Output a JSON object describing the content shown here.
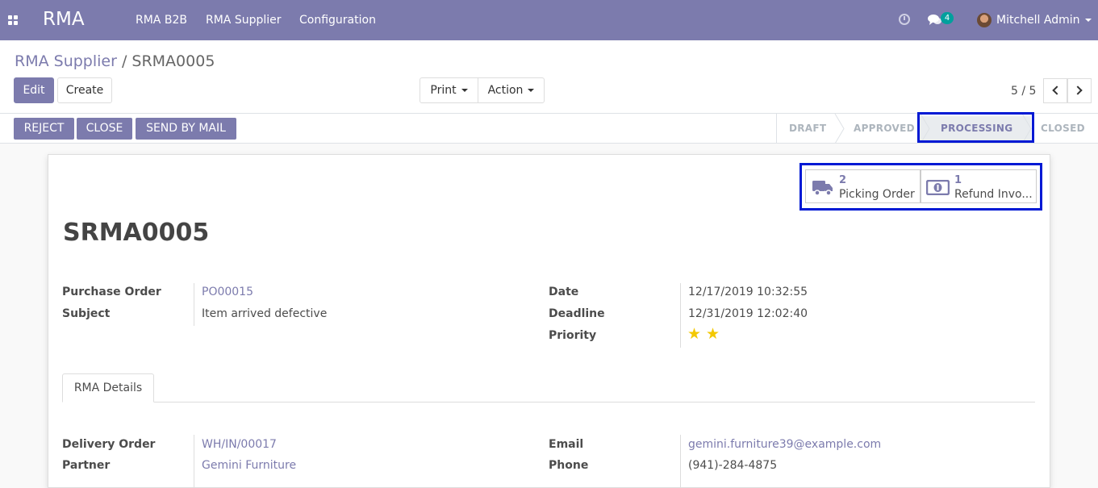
{
  "navbar": {
    "app_name": "RMA",
    "menus": [
      "RMA B2B",
      "RMA Supplier",
      "Configuration"
    ],
    "chat_badge": "4",
    "user_name": "Mitchell Admin",
    "color": "#7c7bad"
  },
  "breadcrumb": {
    "parent": "RMA Supplier",
    "separator": " / ",
    "current": "SRMA0005"
  },
  "buttons": {
    "edit": "Edit",
    "create": "Create",
    "print": "Print",
    "action": "Action"
  },
  "pager": {
    "text": "5 / 5"
  },
  "status_buttons": {
    "reject": "REJECT",
    "close": "CLOSE",
    "send_mail": "SEND BY MAIL"
  },
  "stages": [
    {
      "label": "DRAFT",
      "active": false
    },
    {
      "label": "APPROVED",
      "active": false
    },
    {
      "label": "PROCESSING",
      "active": true
    },
    {
      "label": "CLOSED",
      "active": false
    }
  ],
  "smart_buttons": [
    {
      "count": "2",
      "label": "Picking Order",
      "icon": "truck-icon"
    },
    {
      "count": "1",
      "label": "Refund Invo...",
      "icon": "money-icon"
    }
  ],
  "record": {
    "name": "SRMA0005",
    "purchase_order_label": "Purchase Order",
    "purchase_order": "PO00015",
    "subject_label": "Subject",
    "subject": "Item arrived defective",
    "date_label": "Date",
    "date": "12/17/2019 10:32:55",
    "deadline_label": "Deadline",
    "deadline": "12/31/2019 12:02:40",
    "priority_label": "Priority",
    "priority_stars": 2
  },
  "tabs": {
    "details": "RMA Details"
  },
  "details": {
    "delivery_order_label": "Delivery Order",
    "delivery_order": "WH/IN/00017",
    "partner_label": "Partner",
    "partner": "Gemini Furniture",
    "email_label": "Email",
    "email": "gemini.furniture39@example.com",
    "phone_label": "Phone",
    "phone": "(941)-284-4875"
  }
}
